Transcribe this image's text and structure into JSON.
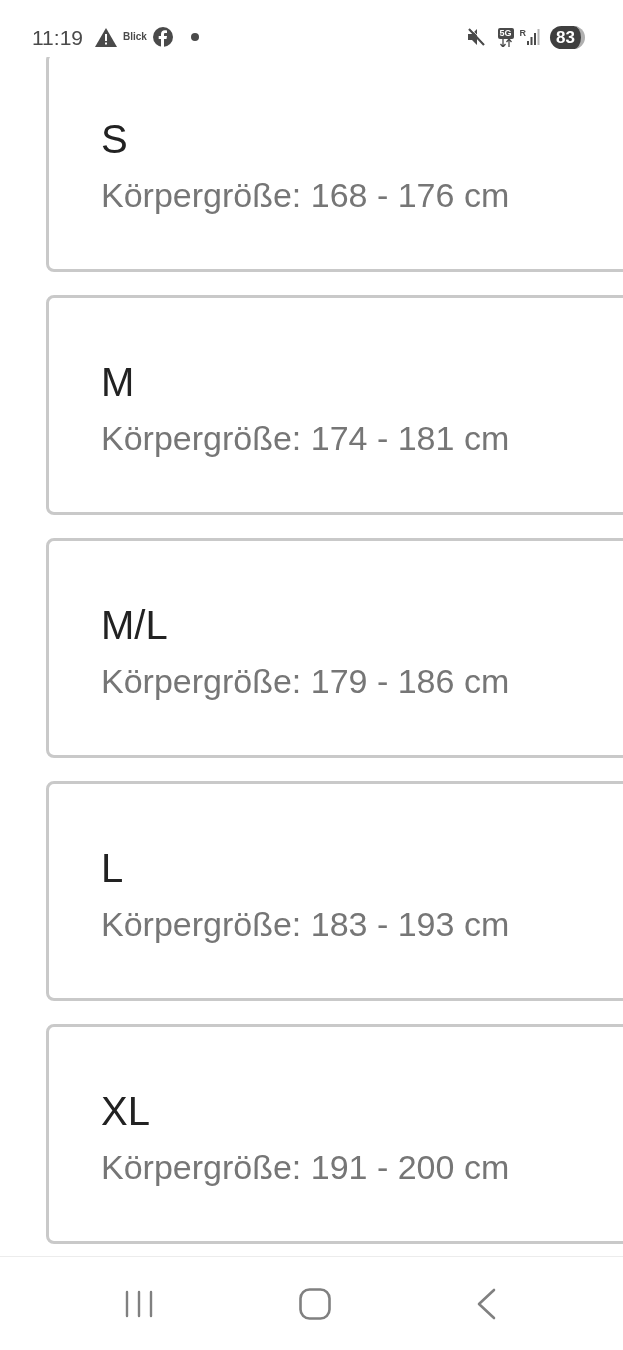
{
  "status_bar": {
    "time": "11:19",
    "notification_label": "Blick",
    "network": "5G",
    "roaming": "R",
    "battery": "83"
  },
  "sizes": [
    {
      "size": "S",
      "body_height": "Körpergröße: 168 - 176 cm"
    },
    {
      "size": "M",
      "body_height": "Körpergröße: 174 - 181 cm"
    },
    {
      "size": "M/L",
      "body_height": "Körpergröße: 179 - 186 cm"
    },
    {
      "size": "L",
      "body_height": "Körpergröße: 183 - 193 cm"
    },
    {
      "size": "XL",
      "body_height": "Körpergröße: 191 - 200 cm"
    }
  ]
}
